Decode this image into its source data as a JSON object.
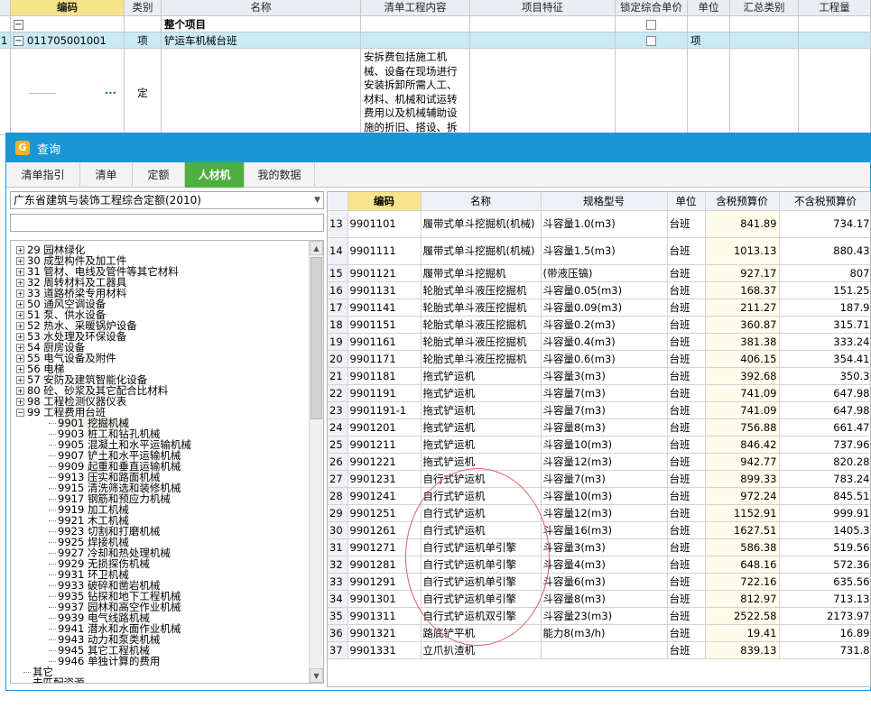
{
  "bg": {
    "headers": [
      "编码",
      "类别",
      "名称",
      "清单工程内容",
      "项目特征",
      "锁定综合单价",
      "单位",
      "汇总类别",
      "工程量"
    ],
    "row1": {
      "toggle": "−",
      "title": "整个项目"
    },
    "row2": {
      "num": "1",
      "toggle": "−",
      "code": "011705001001",
      "type": "项",
      "name": "铲运车机械台班",
      "unit": "项"
    },
    "row3": {
      "dots": "···",
      "type": "定",
      "content": "安拆费包括施工机械、设备在现场进行安装拆卸所需人工、材料、机械和试运转费用以及机械辅助设施的折旧、搭设、拆除等费用"
    }
  },
  "dialog": {
    "title": "查询",
    "icon": "app-logo-icon",
    "tabs": [
      "清单指引",
      "清单",
      "定额",
      "人材机",
      "我的数据"
    ],
    "active_tab": "人材机",
    "library": "广东省建筑与装饰工程综合定额(2010)",
    "tree": [
      {
        "code": "29",
        "label": "园林绿化",
        "exp": "+"
      },
      {
        "code": "30",
        "label": "成型构件及加工件",
        "exp": "+"
      },
      {
        "code": "31",
        "label": "管材、电线及管件等其它材料",
        "exp": "+"
      },
      {
        "code": "32",
        "label": "周转材料及工器具",
        "exp": "+"
      },
      {
        "code": "33",
        "label": "道路桥梁专用材料",
        "exp": "+"
      },
      {
        "code": "50",
        "label": "通风空调设备",
        "exp": "+"
      },
      {
        "code": "51",
        "label": "泵、供水设备",
        "exp": "+"
      },
      {
        "code": "52",
        "label": "热水、采暖锅炉设备",
        "exp": "+"
      },
      {
        "code": "53",
        "label": "水处理及环保设备",
        "exp": "+"
      },
      {
        "code": "54",
        "label": "厨房设备",
        "exp": "+"
      },
      {
        "code": "55",
        "label": "电气设备及附件",
        "exp": "+"
      },
      {
        "code": "56",
        "label": "电梯",
        "exp": "+"
      },
      {
        "code": "57",
        "label": "安防及建筑智能化设备",
        "exp": "+"
      },
      {
        "code": "80",
        "label": "砼、砂浆及其它配合比材料",
        "exp": "+"
      },
      {
        "code": "98",
        "label": "工程检测仪器仪表",
        "exp": "+"
      },
      {
        "code": "99",
        "label": "工程费用台班",
        "exp": "−"
      }
    ],
    "tree_children": [
      {
        "code": "9901",
        "label": "挖掘机械",
        "selected": true
      },
      {
        "code": "9903",
        "label": "桩工和钻孔机械"
      },
      {
        "code": "9905",
        "label": "混凝土和水平运输机械"
      },
      {
        "code": "9907",
        "label": "铲土和水平运输机械"
      },
      {
        "code": "9909",
        "label": "起重和垂直运输机械"
      },
      {
        "code": "9913",
        "label": "压实和路面机械"
      },
      {
        "code": "9915",
        "label": "清洗筛选和装修机械"
      },
      {
        "code": "9917",
        "label": "钢筋和预应力机械"
      },
      {
        "code": "9919",
        "label": "加工机械"
      },
      {
        "code": "9921",
        "label": "木工机械"
      },
      {
        "code": "9923",
        "label": "切割和打磨机械"
      },
      {
        "code": "9925",
        "label": "焊接机械"
      },
      {
        "code": "9927",
        "label": "冷却和热处理机械"
      },
      {
        "code": "9929",
        "label": "无损探伤机械"
      },
      {
        "code": "9931",
        "label": "环卫机械"
      },
      {
        "code": "9933",
        "label": "破碎和凿岩机械"
      },
      {
        "code": "9935",
        "label": "钻探和地下工程机械"
      },
      {
        "code": "9937",
        "label": "园林和高空作业机械"
      },
      {
        "code": "9939",
        "label": "电气线路机械"
      },
      {
        "code": "9941",
        "label": "潜水和水面作业机械"
      },
      {
        "code": "9943",
        "label": "动力和泵类机械"
      },
      {
        "code": "9945",
        "label": "其它工程机械"
      },
      {
        "code": "9946",
        "label": "单独计算的费用"
      }
    ],
    "tree_tail": [
      "其它",
      "未匹配资源"
    ],
    "table": {
      "headers": [
        "",
        "编码",
        "名称",
        "规格型号",
        "单位",
        "含税预算价",
        "不含税预算价"
      ],
      "rows": [
        {
          "n": "13",
          "code": "9901101",
          "name": "履带式单斗挖掘机(机械)",
          "spec": "斗容量1.0(m3)",
          "unit": "台班",
          "p1": "841.89",
          "p2": "734.17",
          "tall": true
        },
        {
          "n": "14",
          "code": "9901111",
          "name": "履带式单斗挖掘机(机械)",
          "spec": "斗容量1.5(m3)",
          "unit": "台班",
          "p1": "1013.13",
          "p2": "880.43",
          "tall": true
        },
        {
          "n": "15",
          "code": "9901121",
          "name": "履带式单斗挖掘机",
          "spec": "(带液压镐)",
          "unit": "台班",
          "p1": "927.17",
          "p2": "807"
        },
        {
          "n": "16",
          "code": "9901131",
          "name": "轮胎式单斗液压挖掘机",
          "spec": "斗容量0.05(m3)",
          "unit": "台班",
          "p1": "168.37",
          "p2": "151.25"
        },
        {
          "n": "17",
          "code": "9901141",
          "name": "轮胎式单斗液压挖掘机",
          "spec": "斗容量0.09(m3)",
          "unit": "台班",
          "p1": "211.27",
          "p2": "187.9"
        },
        {
          "n": "18",
          "code": "9901151",
          "name": "轮胎式单斗液压挖掘机",
          "spec": "斗容量0.2(m3)",
          "unit": "台班",
          "p1": "360.87",
          "p2": "315.71"
        },
        {
          "n": "19",
          "code": "9901161",
          "name": "轮胎式单斗液压挖掘机",
          "spec": "斗容量0.4(m3)",
          "unit": "台班",
          "p1": "381.38",
          "p2": "333.24"
        },
        {
          "n": "20",
          "code": "9901171",
          "name": "轮胎式单斗液压挖掘机",
          "spec": "斗容量0.6(m3)",
          "unit": "台班",
          "p1": "406.15",
          "p2": "354.41"
        },
        {
          "n": "21",
          "code": "9901181",
          "name": "拖式铲运机",
          "spec": "斗容量3(m3)",
          "unit": "台班",
          "p1": "392.68",
          "p2": "350.3"
        },
        {
          "n": "22",
          "code": "9901191",
          "name": "拖式铲运机",
          "spec": "斗容量7(m3)",
          "unit": "台班",
          "p1": "741.09",
          "p2": "647.98"
        },
        {
          "n": "23",
          "code": "9901191-1",
          "name": "拖式铲运机",
          "spec": "斗容量7(m3)",
          "unit": "台班",
          "p1": "741.09",
          "p2": "647.98"
        },
        {
          "n": "24",
          "code": "9901201",
          "name": "拖式铲运机",
          "spec": "斗容量8(m3)",
          "unit": "台班",
          "p1": "756.88",
          "p2": "661.47"
        },
        {
          "n": "25",
          "code": "9901211",
          "name": "拖式铲运机",
          "spec": "斗容量10(m3)",
          "unit": "台班",
          "p1": "846.42",
          "p2": "737.96"
        },
        {
          "n": "26",
          "code": "9901221",
          "name": "拖式铲运机",
          "spec": "斗容量12(m3)",
          "unit": "台班",
          "p1": "942.77",
          "p2": "820.28"
        },
        {
          "n": "27",
          "code": "9901231",
          "name": "自行式铲运机",
          "spec": "斗容量7(m3)",
          "unit": "台班",
          "p1": "899.33",
          "p2": "783.24"
        },
        {
          "n": "28",
          "code": "9901241",
          "name": "自行式铲运机",
          "spec": "斗容量10(m3)",
          "unit": "台班",
          "p1": "972.24",
          "p2": "845.51"
        },
        {
          "n": "29",
          "code": "9901251",
          "name": "自行式铲运机",
          "spec": "斗容量12(m3)",
          "unit": "台班",
          "p1": "1152.91",
          "p2": "999.91"
        },
        {
          "n": "30",
          "code": "9901261",
          "name": "自行式铲运机",
          "spec": "斗容量16(m3)",
          "unit": "台班",
          "p1": "1627.51",
          "p2": "1405.3"
        },
        {
          "n": "31",
          "code": "9901271",
          "name": "自行式铲运机单引擎",
          "spec": "斗容量3(m3)",
          "unit": "台班",
          "p1": "586.38",
          "p2": "519.56"
        },
        {
          "n": "32",
          "code": "9901281",
          "name": "自行式铲运机单引擎",
          "spec": "斗容量4(m3)",
          "unit": "台班",
          "p1": "648.16",
          "p2": "572.36"
        },
        {
          "n": "33",
          "code": "9901291",
          "name": "自行式铲运机单引擎",
          "spec": "斗容量6(m3)",
          "unit": "台班",
          "p1": "722.16",
          "p2": "635.56"
        },
        {
          "n": "34",
          "code": "9901301",
          "name": "自行式铲运机单引擎",
          "spec": "斗容量8(m3)",
          "unit": "台班",
          "p1": "812.97",
          "p2": "713.13"
        },
        {
          "n": "35",
          "code": "9901311",
          "name": "自行式铲运机双引擎",
          "spec": "斗容量23(m3)",
          "unit": "台班",
          "p1": "2522.58",
          "p2": "2173.97"
        },
        {
          "n": "36",
          "code": "9901321",
          "name": "路底铲平机",
          "spec": "能力8(m3/h)",
          "unit": "台班",
          "p1": "19.41",
          "p2": "16.89"
        },
        {
          "n": "37",
          "code": "9901331",
          "name": "立爪扒渣机",
          "spec": "",
          "unit": "台班",
          "p1": "839.13",
          "p2": "731.8"
        }
      ]
    }
  }
}
